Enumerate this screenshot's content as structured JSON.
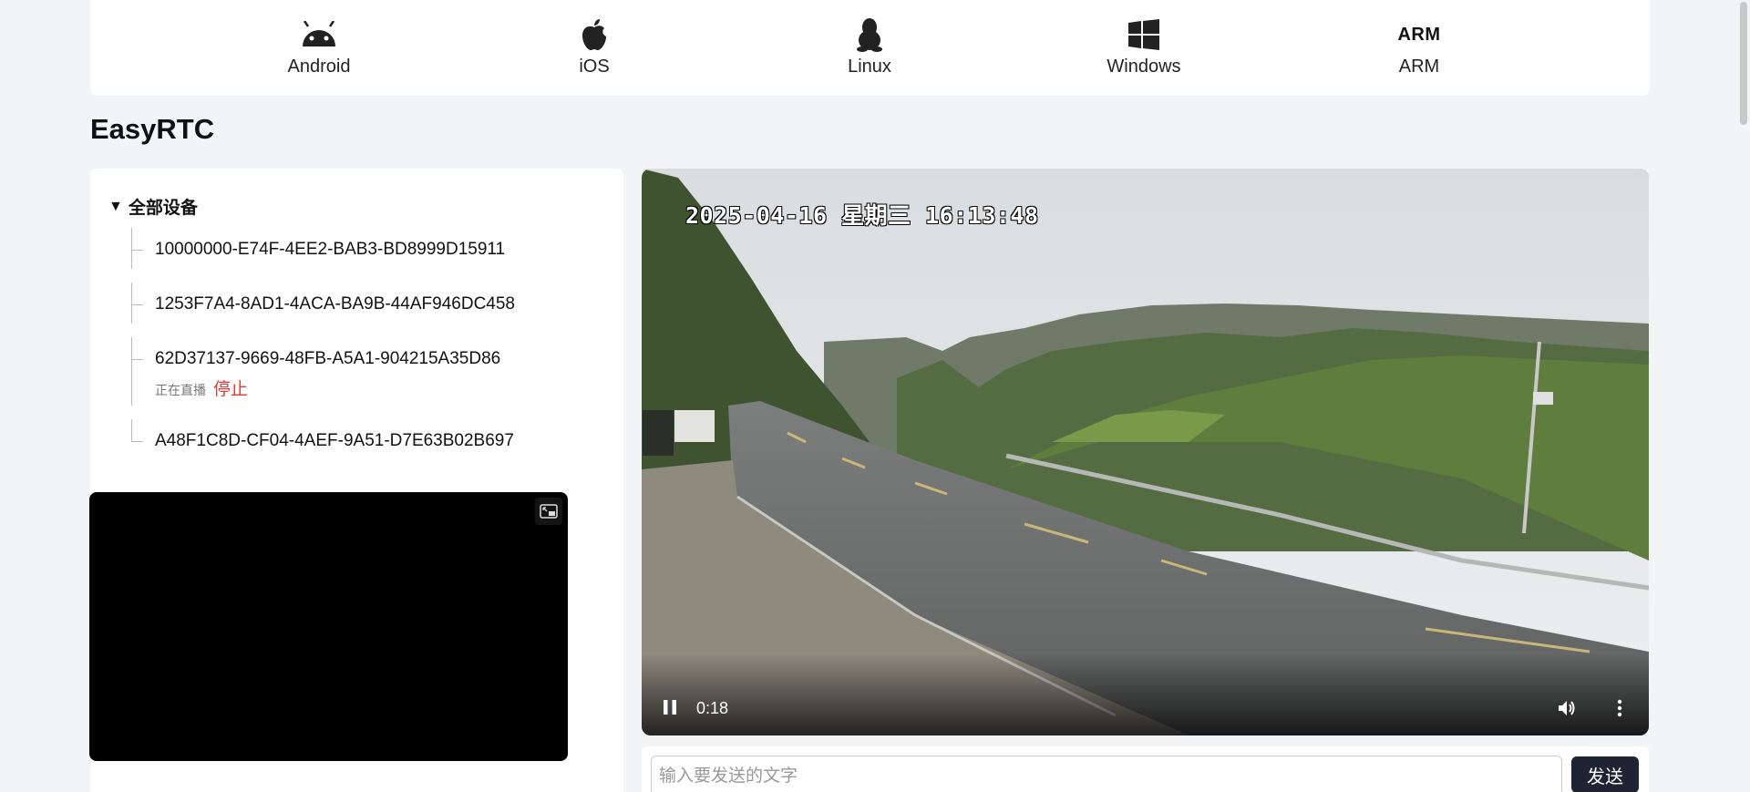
{
  "platforms": [
    {
      "label": "Android",
      "icon": "android-icon"
    },
    {
      "label": "iOS",
      "icon": "apple-icon"
    },
    {
      "label": "Linux",
      "icon": "linux-icon"
    },
    {
      "label": "Windows",
      "icon": "windows-icon"
    },
    {
      "label": "ARM",
      "icon": "arm-icon",
      "icon_text": "ARM"
    }
  ],
  "page_title": "EasyRTC",
  "device_tree": {
    "root_label": "全部设备",
    "devices": [
      {
        "id": "10000000-E74F-4EE2-BAB3-BD8999D15911"
      },
      {
        "id": "1253F7A4-8AD1-4ACA-BA9B-44AF946DC458"
      },
      {
        "id": "62D37137-9669-48FB-A5A1-904215A35D86",
        "status": "正在直播",
        "action": "停止"
      },
      {
        "id": "A48F1C8D-CF04-4AEF-9A51-D7E63B02B697"
      }
    ]
  },
  "main_video": {
    "osd_timestamp": "2025-04-16 星期三 16:13:48",
    "elapsed": "0:18"
  },
  "chat": {
    "placeholder": "输入要发送的文字",
    "value": "",
    "send_label": "发送"
  },
  "colors": {
    "stop": "#e53935",
    "send_button": "#1e2433",
    "background": "#f3f4f6"
  }
}
